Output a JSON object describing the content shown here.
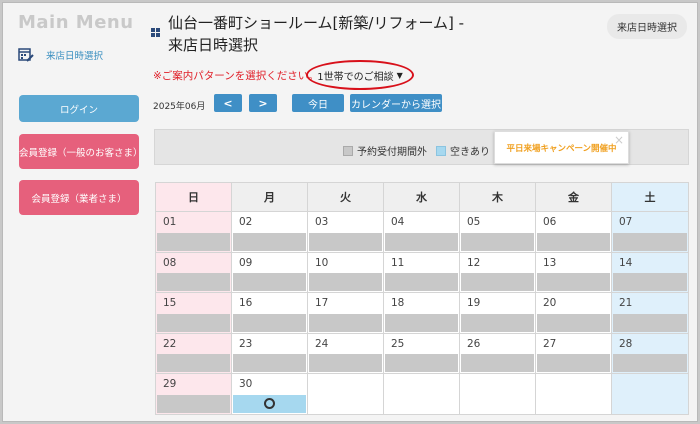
{
  "sidebar": {
    "menu_title": "Main Menu",
    "calendar_link": "来店日時選択",
    "login": "ログイン",
    "register_general": "会員登録（一般のお客さま）",
    "register_business": "会員登録（業者さま）"
  },
  "header": {
    "title_line1": "仙台一番町ショールーム[新築/リフォーム] -",
    "title_line2": "来店日時選択",
    "badge": "来店日時選択"
  },
  "controls": {
    "notice": "※ご案内パターンを選択ください。",
    "pattern_selected": "1世帯でのご相談",
    "month": "2025年06月",
    "prev": "<",
    "next": ">",
    "today": "今日",
    "calendar_select": "カレンダーから選択"
  },
  "legend": {
    "closed": "予約受付期間外",
    "available": "空きあり",
    "campaign": "平日来場キャンペーン開催中",
    "close": "×"
  },
  "colors": {
    "accent_blue": "#3f8fc6",
    "accent_pink": "#e6607c",
    "alert_red": "#e0202a",
    "available": "#a6d8ef",
    "closed": "#c8c8c8"
  },
  "calendar": {
    "weekdays": [
      "日",
      "月",
      "火",
      "水",
      "木",
      "金",
      "土"
    ],
    "weeks": [
      [
        {
          "d": "01",
          "s": "closed"
        },
        {
          "d": "02",
          "s": "closed"
        },
        {
          "d": "03",
          "s": "closed"
        },
        {
          "d": "04",
          "s": "closed"
        },
        {
          "d": "05",
          "s": "closed"
        },
        {
          "d": "06",
          "s": "closed"
        },
        {
          "d": "07",
          "s": "closed"
        }
      ],
      [
        {
          "d": "08",
          "s": "closed"
        },
        {
          "d": "09",
          "s": "closed"
        },
        {
          "d": "10",
          "s": "closed"
        },
        {
          "d": "11",
          "s": "closed"
        },
        {
          "d": "12",
          "s": "closed"
        },
        {
          "d": "13",
          "s": "closed"
        },
        {
          "d": "14",
          "s": "closed"
        }
      ],
      [
        {
          "d": "15",
          "s": "closed"
        },
        {
          "d": "16",
          "s": "closed"
        },
        {
          "d": "17",
          "s": "closed"
        },
        {
          "d": "18",
          "s": "closed"
        },
        {
          "d": "19",
          "s": "closed"
        },
        {
          "d": "20",
          "s": "closed"
        },
        {
          "d": "21",
          "s": "closed"
        }
      ],
      [
        {
          "d": "22",
          "s": "closed"
        },
        {
          "d": "23",
          "s": "closed"
        },
        {
          "d": "24",
          "s": "closed"
        },
        {
          "d": "25",
          "s": "closed"
        },
        {
          "d": "26",
          "s": "closed"
        },
        {
          "d": "27",
          "s": "closed"
        },
        {
          "d": "28",
          "s": "closed"
        }
      ],
      [
        {
          "d": "29",
          "s": "closed"
        },
        {
          "d": "30",
          "s": "available"
        },
        {
          "d": "",
          "s": "none"
        },
        {
          "d": "",
          "s": "none"
        },
        {
          "d": "",
          "s": "none"
        },
        {
          "d": "",
          "s": "none"
        },
        {
          "d": "",
          "s": "none"
        }
      ]
    ]
  }
}
